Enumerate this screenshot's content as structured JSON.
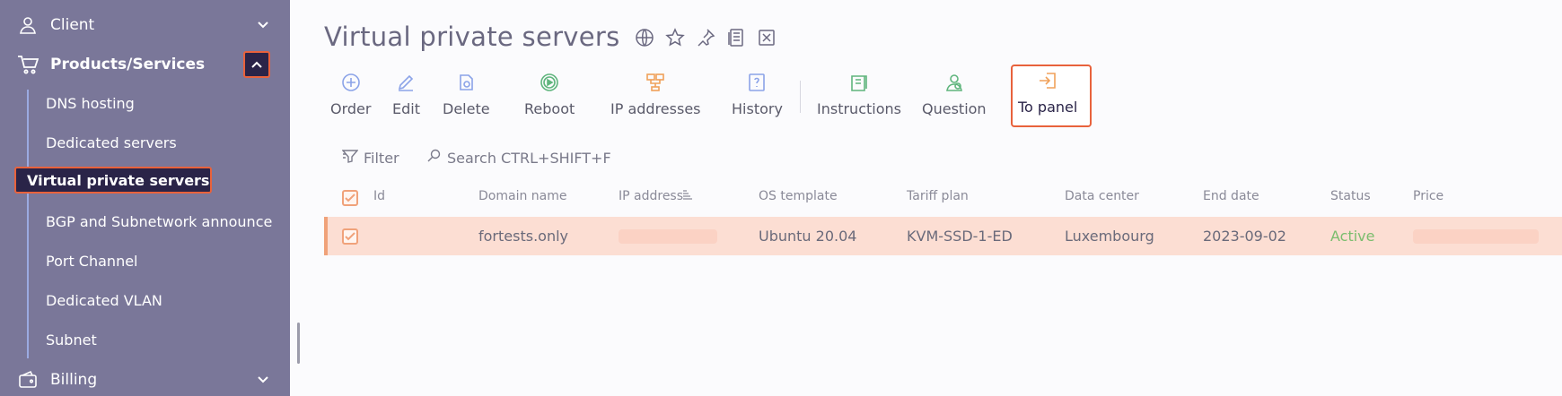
{
  "sidebar": {
    "client": "Client",
    "products": "Products/Services",
    "sub_items": [
      "DNS hosting",
      "Dedicated servers",
      "Virtual private servers",
      "BGP and Subnetwork announce",
      "Port Channel",
      "Dedicated VLAN",
      "Subnet"
    ],
    "billing": "Billing"
  },
  "page": {
    "title": "Virtual private servers"
  },
  "toolbar": {
    "order": "Order",
    "edit": "Edit",
    "delete": "Delete",
    "reboot": "Reboot",
    "ip_addresses": "IP addresses",
    "history": "History",
    "instructions": "Instructions",
    "question": "Question",
    "to_panel": "To panel"
  },
  "filterbar": {
    "filter": "Filter",
    "search": "Search CTRL+SHIFT+F"
  },
  "table": {
    "columns": [
      "Id",
      "Domain name",
      "IP address",
      "OS template",
      "Tariff plan",
      "Data center",
      "End date",
      "Status",
      "Price"
    ],
    "rows": [
      {
        "id": "",
        "domain": "fortests.only",
        "ip": "",
        "os": "Ubuntu 20.04",
        "tariff": "KVM-SSD-1-ED",
        "datacenter": "Luxembourg",
        "end_date": "2023-09-02",
        "status": "Active",
        "price": ""
      }
    ]
  },
  "colors": {
    "sidebar_bg": "#7a7799",
    "active_bg": "#2a2448",
    "highlight": "#e8623c",
    "row_bg": "#fcded3",
    "status_active": "#7bbd6e"
  }
}
